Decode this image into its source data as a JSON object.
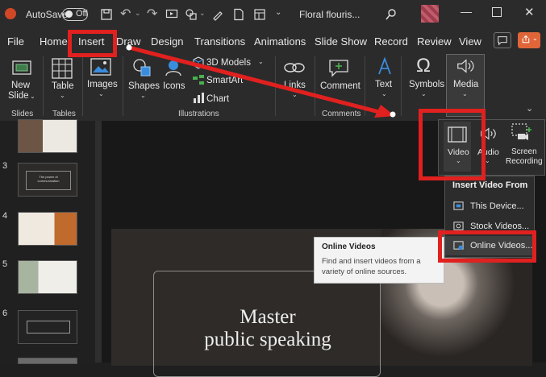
{
  "titlebar": {
    "autosave_label": "AutoSave",
    "autosave_state": "Off",
    "filename": "Floral flouris..."
  },
  "menu": [
    "File",
    "Home",
    "Insert",
    "Draw",
    "Design",
    "Transitions",
    "Animations",
    "Slide Show",
    "Record",
    "Review",
    "View"
  ],
  "ribbon": {
    "new_slide": [
      "New",
      "Slide"
    ],
    "table": "Table",
    "images": "Images",
    "shapes": "Shapes",
    "icons": "Icons",
    "models3d": "3D Models",
    "smartart": "SmartArt",
    "chart": "Chart",
    "links": "Links",
    "comment": "Comment",
    "text": "Text",
    "symbols": "Symbols",
    "media": "Media",
    "groups": {
      "slides": "Slides",
      "tables": "Tables",
      "illustrations": "Illustrations",
      "comments": "Comments"
    }
  },
  "media_dropdown": {
    "video": "Video",
    "audio": "Audio",
    "screen_recording": [
      "Screen",
      "Recording"
    ]
  },
  "video_menu": {
    "header": "Insert Video From",
    "items": [
      "This Device...",
      "Stock Videos...",
      "Online Videos..."
    ]
  },
  "tooltip": {
    "title": "Online Videos",
    "body": [
      "Find and insert videos from a",
      "variety of online sources."
    ]
  },
  "thumbnails": {
    "numbers": [
      "3",
      "4",
      "5",
      "6"
    ],
    "t3": "The power of communication"
  },
  "slide": {
    "title_line1": "Master",
    "title_line2": "public speaking"
  },
  "colors": {
    "highlight": "#e0211f",
    "app_bg": "#2b2b2b",
    "powerpoint_logo": "#d24726"
  }
}
